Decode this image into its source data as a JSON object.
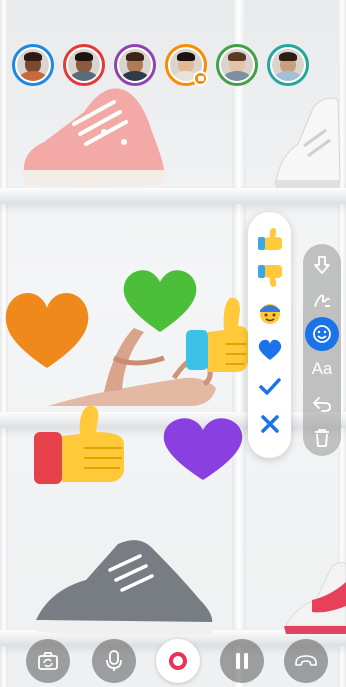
{
  "participants": [
    {
      "name": "participant-1",
      "ring": "#1e88e5",
      "skin": "#7a4a2f",
      "hair": "#2b1b12",
      "shirt": "#c66a3a"
    },
    {
      "name": "participant-2",
      "ring": "#e53935",
      "skin": "#8a5a3b",
      "hair": "#1d1410",
      "shirt": "#5b6b7a"
    },
    {
      "name": "participant-3",
      "ring": "#8e44ad",
      "skin": "#b07a55",
      "hair": "#3a2618",
      "shirt": "#2f3b4a"
    },
    {
      "name": "participant-4",
      "ring": "#fb8c00",
      "skin": "#e3b894",
      "hair": "#1a1210",
      "shirt": "#e8e2da",
      "badge": "camera-icon"
    },
    {
      "name": "participant-5",
      "ring": "#43a047",
      "skin": "#e6c3a5",
      "hair": "#5a3a22",
      "shirt": "#7d8fa3"
    },
    {
      "name": "participant-6",
      "ring": "#26a69a",
      "skin": "#c9a07a",
      "hair": "#2d1d14",
      "shirt": "#a3c0d6"
    }
  ],
  "palette": {
    "items": [
      {
        "name": "thumbs-up-icon"
      },
      {
        "name": "thumbs-down-icon"
      },
      {
        "name": "face-emoji-icon"
      },
      {
        "name": "heart-icon"
      },
      {
        "name": "checkmark-icon"
      },
      {
        "name": "cross-icon"
      }
    ]
  },
  "tools": {
    "text_label": "Aa",
    "items": [
      "arrow-down-icon",
      "pen-icon",
      "emoji-icon",
      "text-icon",
      "undo-icon",
      "trash-icon"
    ],
    "active": "emoji-icon"
  },
  "controls": [
    "flip-camera-icon",
    "microphone-icon",
    "record-icon",
    "pause-icon",
    "end-call-icon"
  ],
  "colors": {
    "accent": "#1a73e8",
    "record": "#e8325a",
    "heart_orange": "#f0891c",
    "heart_green": "#4cbe3a",
    "heart_purple": "#8a3fe0",
    "thumb_yellow": "#ffc93a",
    "thumb_cuff": "#3cc2e6"
  }
}
